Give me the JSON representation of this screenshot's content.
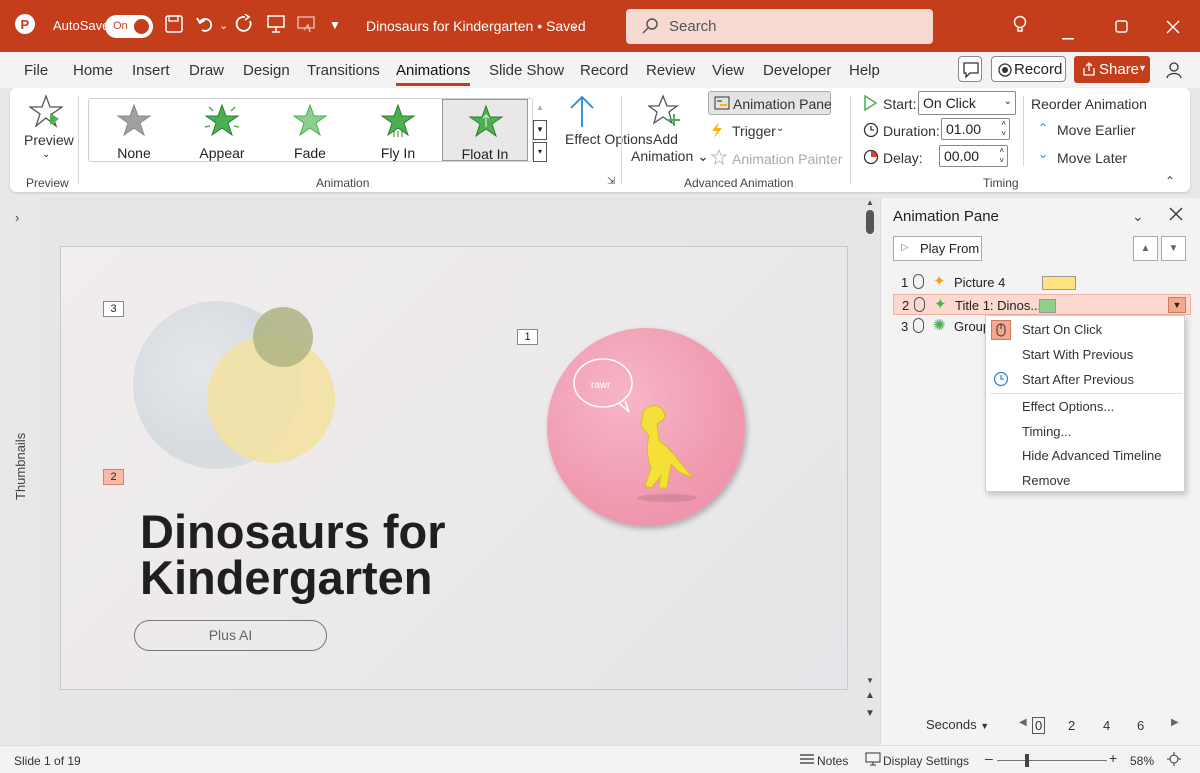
{
  "titlebar": {
    "autosave_label": "AutoSave",
    "autosave_state": "On",
    "doc_title": "Dinosaurs for Kindergarten • Saved",
    "search_placeholder": "Search"
  },
  "menubar": {
    "tabs": [
      "File",
      "Home",
      "Insert",
      "Draw",
      "Design",
      "Transitions",
      "Animations",
      "Slide Show",
      "Record",
      "Review",
      "View",
      "Developer",
      "Help"
    ],
    "active_tab": "Animations",
    "record_label": "Record",
    "share_label": "Share"
  },
  "ribbon": {
    "preview": {
      "label": "Preview",
      "group": "Preview"
    },
    "animation_gallery": {
      "items": [
        {
          "label": "None",
          "icon": "star-gray-icon"
        },
        {
          "label": "Appear",
          "icon": "star-burst-green-icon"
        },
        {
          "label": "Fade",
          "icon": "star-green-icon"
        },
        {
          "label": "Fly In",
          "icon": "star-fly-green-icon"
        },
        {
          "label": "Float In",
          "icon": "star-float-green-icon"
        }
      ],
      "selected": "Float In",
      "effect_options": "Effect Options",
      "group": "Animation"
    },
    "advanced": {
      "add_animation": "Add Animation",
      "animation_pane": "Animation Pane",
      "trigger": "Trigger",
      "animation_painter": "Animation Painter",
      "group": "Advanced Animation"
    },
    "timing": {
      "start_label": "Start:",
      "start_value": "On Click",
      "duration_label": "Duration:",
      "duration_value": "01.00",
      "delay_label": "Delay:",
      "delay_value": "00.00",
      "reorder": "Reorder Animation",
      "move_earlier": "Move Earlier",
      "move_later": "Move Later",
      "group": "Timing"
    }
  },
  "sidebar": {
    "thumbnails_label": "Thumbnails"
  },
  "slide": {
    "title_line1": "Dinosaurs for",
    "title_line2": "Kindergarten",
    "button_text": "Plus AI",
    "speech_bubble": "rawr",
    "markers": [
      "3",
      "1",
      "2"
    ]
  },
  "animation_pane": {
    "title": "Animation Pane",
    "play_from": "Play From",
    "items": [
      {
        "num": "1",
        "label": "Picture 4",
        "color": "#ffe380"
      },
      {
        "num": "2",
        "label": "Title 1: Dinos...",
        "color": "#8fd18a"
      },
      {
        "num": "3",
        "label": "Group"
      }
    ],
    "context_menu": [
      "Start On Click",
      "Start With Previous",
      "Start After Previous",
      "Effect Options...",
      "Timing...",
      "Hide Advanced Timeline",
      "Remove"
    ],
    "seconds_label": "Seconds",
    "timeline_ticks": [
      "0",
      "2",
      "4",
      "6"
    ]
  },
  "statusbar": {
    "slide_info": "Slide 1 of 19",
    "notes": "Notes",
    "display_settings": "Display Settings",
    "zoom": "58%"
  },
  "colors": {
    "accent": "#c43e1c",
    "anim_green": "#4caf50"
  }
}
